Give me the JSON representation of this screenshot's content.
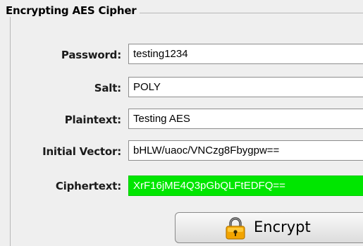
{
  "panel": {
    "title": "Encrypting AES Cipher"
  },
  "form": {
    "password": {
      "label": "Password:",
      "value": "testing1234"
    },
    "salt": {
      "label": "Salt:",
      "value": "POLY"
    },
    "plaintext": {
      "label": "Plaintext:",
      "value": "Testing AES"
    },
    "initial_vector": {
      "label": "Initial Vector:",
      "value": "bHLW/uaoc/VNCzg8Fbygpw=="
    },
    "ciphertext": {
      "label": "Ciphertext:",
      "value": "XrF16jME4Q3pGbQLFtEDFQ=="
    }
  },
  "encrypt_button": {
    "label": "Encrypt",
    "icon": "lock-icon"
  },
  "colors": {
    "ciphertext_bg": "#00e600",
    "ciphertext_text": "#ffffff",
    "lock_icon": "#f2a400"
  }
}
